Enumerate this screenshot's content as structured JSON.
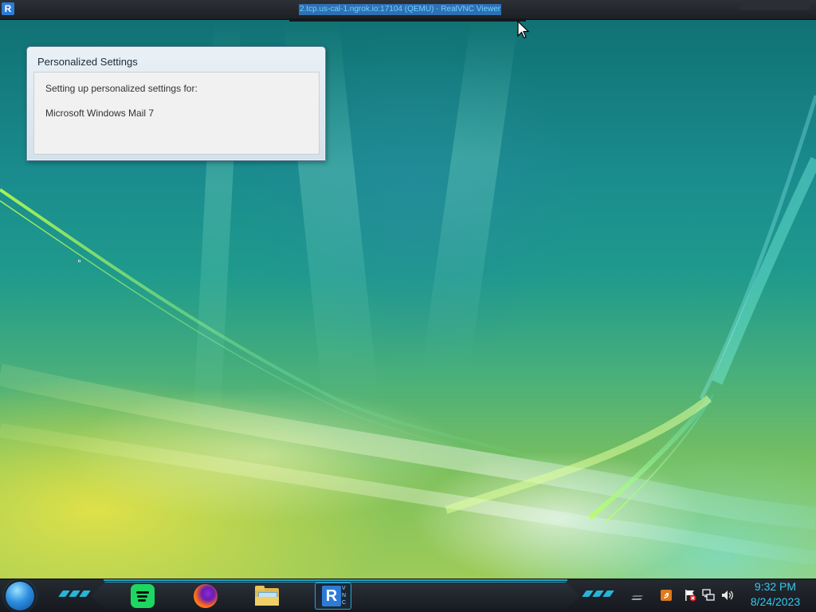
{
  "vnc": {
    "title": "2.tcp.us-cal-1.ngrok.io:17104 (QEMU) - RealVNC Viewer",
    "logo_letter": "R"
  },
  "dialog": {
    "title": "Personalized Settings",
    "line1": "Setting up personalized settings for:",
    "line2": "Microsoft Windows Mail 7"
  },
  "taskbar": {
    "start_icon": "windows-orb-icon",
    "apps": [
      {
        "icon": "spotify-icon",
        "color": "#1ed760"
      },
      {
        "icon": "firefox-icon",
        "color": "#ff7a1a"
      },
      {
        "icon": "file-explorer-icon",
        "color": "#e8c45a"
      },
      {
        "icon": "realvnc-icon",
        "color": "#2e7bd6"
      }
    ],
    "vnc_letters": "VNC",
    "tray_icons": [
      "show-desktop-icon",
      "java-update-icon",
      "action-center-flag-icon",
      "network-icon",
      "volume-icon"
    ],
    "accent_color": "#2ab3d6"
  },
  "clock": {
    "time": "9:32 PM",
    "date": "8/24/2023"
  }
}
